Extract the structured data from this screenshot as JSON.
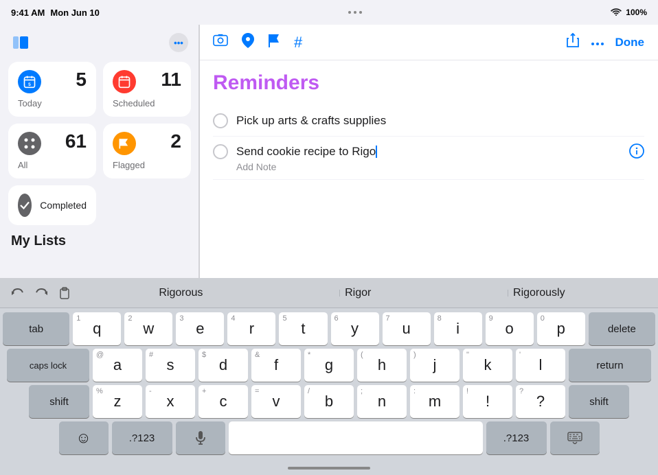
{
  "statusBar": {
    "time": "9:41 AM",
    "date": "Mon Jun 10",
    "dots": [
      "•",
      "•",
      "•"
    ],
    "wifi": "WiFi",
    "battery": "100%"
  },
  "sidebar": {
    "toggleIcon": "⊞",
    "moreIcon": "•••",
    "smartLists": [
      {
        "id": "today",
        "label": "Today",
        "count": "5",
        "iconColor": "#007aff",
        "icon": "📅"
      },
      {
        "id": "scheduled",
        "label": "Scheduled",
        "count": "11",
        "iconColor": "#ff3b30",
        "icon": "📅"
      },
      {
        "id": "all",
        "label": "All",
        "count": "61",
        "iconColor": "#1c1c1e",
        "icon": "⊞"
      },
      {
        "id": "flagged",
        "label": "Flagged",
        "count": "2",
        "iconColor": "#ff9500",
        "icon": "⚑"
      }
    ],
    "completedLabel": "Completed",
    "myListsLabel": "My Lists"
  },
  "toolbar": {
    "icons": [
      "🖼",
      "➤",
      "⚑",
      "#"
    ],
    "shareIcon": "↑",
    "moreIcon": "•••",
    "doneLabel": "Done"
  },
  "reminders": {
    "title": "Reminders",
    "items": [
      {
        "id": "item1",
        "text": "Pick up arts & crafts supplies",
        "note": "",
        "checked": false
      },
      {
        "id": "item2",
        "text": "Send cookie recipe to Rigo",
        "note": "Add Note",
        "checked": false,
        "editing": true
      }
    ]
  },
  "keyboard": {
    "suggestions": [
      "Rigorous",
      "Rigor",
      "Rigorously"
    ],
    "rows": [
      {
        "keys": [
          {
            "label": "q",
            "num": "1",
            "type": "letter"
          },
          {
            "label": "w",
            "num": "2",
            "type": "letter"
          },
          {
            "label": "e",
            "num": "3",
            "type": "letter"
          },
          {
            "label": "r",
            "num": "4",
            "type": "letter"
          },
          {
            "label": "t",
            "num": "5",
            "type": "letter"
          },
          {
            "label": "y",
            "num": "6",
            "type": "letter"
          },
          {
            "label": "u",
            "num": "7",
            "type": "letter"
          },
          {
            "label": "i",
            "num": "8",
            "type": "letter"
          },
          {
            "label": "o",
            "num": "9",
            "type": "letter"
          },
          {
            "label": "p",
            "num": "0",
            "type": "letter"
          }
        ]
      },
      {
        "keys": [
          {
            "label": "a",
            "num": "@",
            "type": "letter"
          },
          {
            "label": "s",
            "num": "#",
            "type": "letter"
          },
          {
            "label": "d",
            "num": "$",
            "type": "letter"
          },
          {
            "label": "f",
            "num": "&",
            "type": "letter"
          },
          {
            "label": "g",
            "num": "*",
            "type": "letter"
          },
          {
            "label": "h",
            "num": "(",
            "type": "letter"
          },
          {
            "label": "j",
            "num": ")",
            "type": "letter"
          },
          {
            "label": "k",
            "num": "\"",
            "type": "letter"
          },
          {
            "label": "l",
            "num": "'",
            "type": "letter"
          }
        ]
      },
      {
        "keys": [
          {
            "label": "z",
            "num": "%",
            "type": "letter"
          },
          {
            "label": "x",
            "num": "-",
            "type": "letter"
          },
          {
            "label": "c",
            "num": "+",
            "type": "letter"
          },
          {
            "label": "v",
            "num": "=",
            "type": "letter"
          },
          {
            "label": "b",
            "num": "/",
            "type": "letter"
          },
          {
            "label": "n",
            "num": ";",
            "type": "letter"
          },
          {
            "label": "m",
            "num": ":",
            "type": "letter"
          },
          {
            "label": "!",
            "num": "!",
            "type": "letter"
          },
          {
            "label": "?",
            "num": "?",
            "type": "letter"
          }
        ]
      }
    ],
    "specialKeys": {
      "tab": "tab",
      "delete": "delete",
      "capsLock": "caps lock",
      "return": "return",
      "shiftLeft": "shift",
      "shiftRight": "shift",
      "emoji": "☺",
      "numbers": ".?123",
      "microphone": "🎤",
      "space": "",
      "numbers2": ".?123",
      "hide": "⌨"
    }
  }
}
